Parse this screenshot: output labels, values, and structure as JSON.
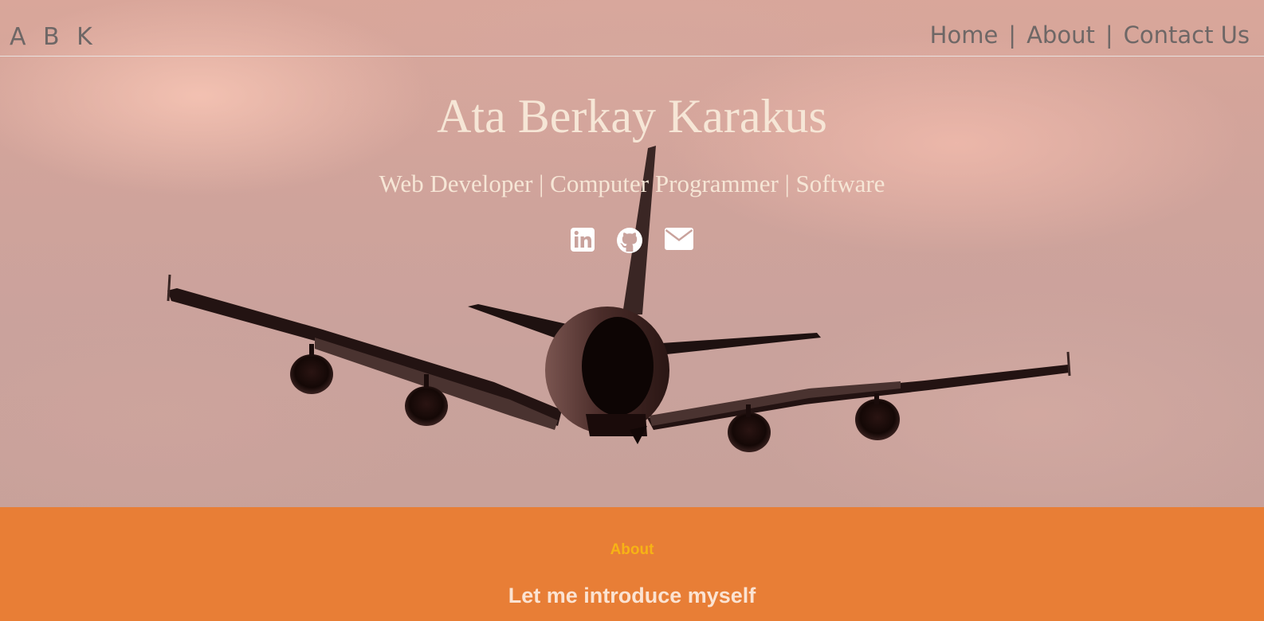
{
  "nav": {
    "brand": "A B K",
    "links": [
      {
        "label": "Home"
      },
      {
        "label": "About"
      },
      {
        "label": "Contact Us"
      }
    ],
    "separator": "|"
  },
  "hero": {
    "title": "Ata Berkay Karakus",
    "subtitle": "Web Developer | Computer Programmer | Software",
    "socials": [
      {
        "icon": "linkedin-icon"
      },
      {
        "icon": "github-icon"
      },
      {
        "icon": "mail-icon"
      }
    ]
  },
  "about": {
    "label": "About",
    "heading": "Let me introduce myself",
    "background": "#e87e36",
    "label_color": "#f7b315"
  }
}
